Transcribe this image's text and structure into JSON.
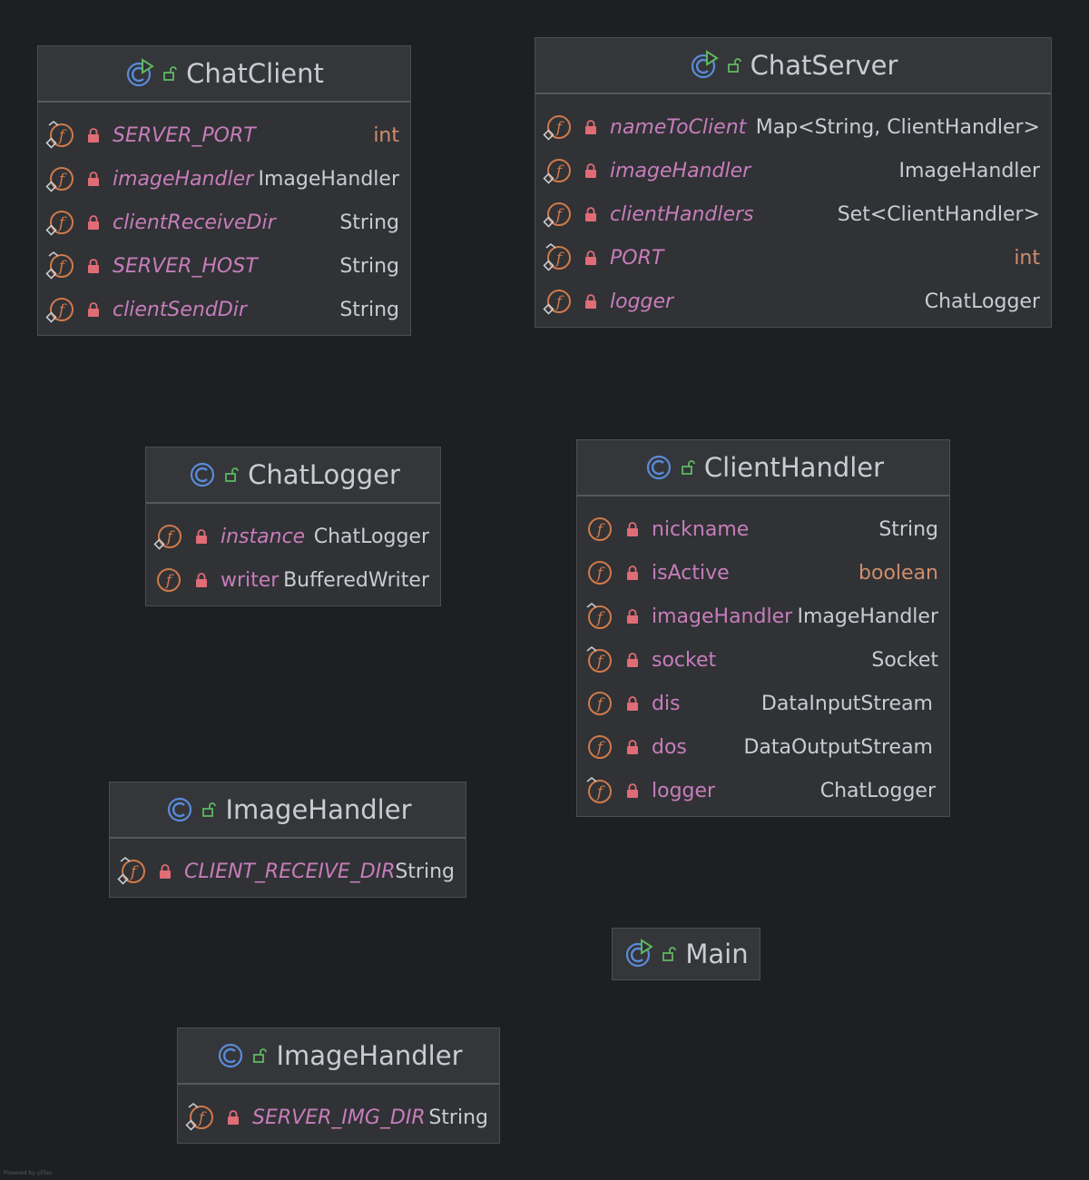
{
  "classes": [
    {
      "id": "chatclient",
      "name": "ChatClient",
      "kind": "class-runnable",
      "fields": [
        {
          "name": "SERVER_PORT",
          "type": "int",
          "static": true,
          "final": true,
          "primitive": true
        },
        {
          "name": "imageHandler",
          "type": "ImageHandler",
          "static": true,
          "final": false,
          "primitive": false
        },
        {
          "name": "clientReceiveDir",
          "type": "String",
          "static": true,
          "final": false,
          "primitive": false
        },
        {
          "name": "SERVER_HOST",
          "type": "String",
          "static": true,
          "final": true,
          "primitive": false
        },
        {
          "name": "clientSendDir",
          "type": "String",
          "static": true,
          "final": false,
          "primitive": false
        }
      ]
    },
    {
      "id": "chatserver",
      "name": "ChatServer",
      "kind": "class-runnable",
      "fields": [
        {
          "name": "nameToClient",
          "type": "Map<String, ClientHandler>",
          "static": true,
          "final": false,
          "primitive": false
        },
        {
          "name": "imageHandler",
          "type": "ImageHandler",
          "static": true,
          "final": false,
          "primitive": false
        },
        {
          "name": "clientHandlers",
          "type": "Set<ClientHandler>",
          "static": true,
          "final": false,
          "primitive": false
        },
        {
          "name": "PORT",
          "type": "int",
          "static": true,
          "final": true,
          "primitive": true
        },
        {
          "name": "logger",
          "type": "ChatLogger",
          "static": true,
          "final": false,
          "primitive": false
        }
      ]
    },
    {
      "id": "chatlogger",
      "name": "ChatLogger",
      "kind": "class",
      "fields": [
        {
          "name": "instance",
          "type": "ChatLogger",
          "static": true,
          "final": false,
          "primitive": false
        },
        {
          "name": "writer",
          "type": "BufferedWriter",
          "static": false,
          "final": false,
          "primitive": false
        }
      ]
    },
    {
      "id": "clienthandler",
      "name": "ClientHandler",
      "kind": "class",
      "fields": [
        {
          "name": "nickname",
          "type": "String",
          "static": false,
          "final": false,
          "primitive": false
        },
        {
          "name": "isActive",
          "type": "boolean",
          "static": false,
          "final": false,
          "primitive": true
        },
        {
          "name": "imageHandler",
          "type": "ImageHandler",
          "static": false,
          "final": true,
          "primitive": false
        },
        {
          "name": "socket",
          "type": "Socket",
          "static": false,
          "final": true,
          "primitive": false
        },
        {
          "name": "dis",
          "type": "DataInputStream",
          "static": false,
          "final": false,
          "primitive": false
        },
        {
          "name": "dos",
          "type": "DataOutputStream",
          "static": false,
          "final": false,
          "primitive": false
        },
        {
          "name": "logger",
          "type": "ChatLogger",
          "static": false,
          "final": true,
          "primitive": false
        }
      ]
    },
    {
      "id": "imagehandler-client",
      "name": "ImageHandler",
      "kind": "class",
      "fields": [
        {
          "name": "CLIENT_RECEIVE_DIR",
          "type": "String",
          "static": true,
          "final": true,
          "primitive": false
        }
      ]
    },
    {
      "id": "main",
      "name": "Main",
      "kind": "class-runnable",
      "fields": []
    },
    {
      "id": "imagehandler-server",
      "name": "ImageHandler",
      "kind": "class",
      "fields": [
        {
          "name": "SERVER_IMG_DIR",
          "type": "String",
          "static": true,
          "final": true,
          "primitive": false
        }
      ]
    }
  ],
  "colors": {
    "background": "#1e1f22",
    "field_name": "#c77dba",
    "type_text": "#c9ccd1",
    "primitive_type": "#cf8e6d",
    "field_icon": "#d07a4a",
    "class_icon": "#5a8bd8",
    "run_badge": "#5fb85f",
    "lock": "#e06c75",
    "visibility": "#5fb85f"
  },
  "footer": "Powered by yFiles"
}
